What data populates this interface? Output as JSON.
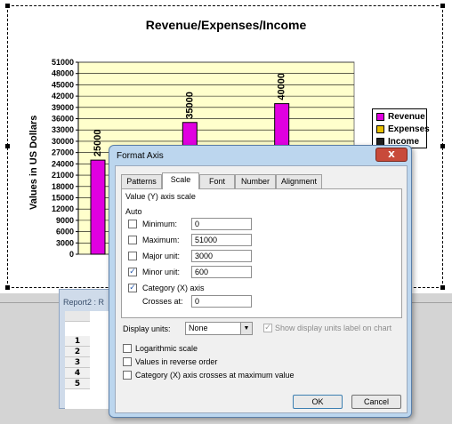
{
  "chart": {
    "title": "Revenue/Expenses/Income",
    "ylabel": "Values in US Dollars",
    "legend": [
      {
        "label": "Revenue",
        "color": "#e000e0"
      },
      {
        "label": "Expenses",
        "color": "#e8c000"
      },
      {
        "label": "Income",
        "color": "#202020"
      }
    ]
  },
  "chart_data": {
    "type": "bar",
    "title": "Revenue/Expenses/Income",
    "xlabel": "",
    "ylabel": "Values in US Dollars",
    "ylim": [
      0,
      51000
    ],
    "y_ticks": [
      0,
      3000,
      6000,
      9000,
      12000,
      15000,
      18000,
      21000,
      24000,
      27000,
      30000,
      33000,
      36000,
      39000,
      42000,
      45000,
      48000,
      51000
    ],
    "series": [
      {
        "name": "Revenue",
        "color": "#e000e0",
        "values": [
          25000,
          35000,
          40000
        ]
      },
      {
        "name": "Expenses",
        "color": "#e8c000",
        "values": [
          null,
          null,
          null
        ]
      },
      {
        "name": "Income",
        "color": "#202020",
        "values": [
          null,
          null,
          null
        ]
      }
    ],
    "data_labels": [
      "25000",
      "35000",
      "40000"
    ],
    "grid": true,
    "plot_background": "#ffffcc",
    "legend_position": "right"
  },
  "report": {
    "title": "Report2 : R",
    "rows": [
      "1",
      "2",
      "3",
      "4",
      "5"
    ]
  },
  "dialog": {
    "title": "Format Axis",
    "close_label": "X",
    "tabs": [
      "Patterns",
      "Scale",
      "Font",
      "Number",
      "Alignment"
    ],
    "active_tab": "Scale",
    "section_title": "Value (Y) axis scale",
    "auto_label": "Auto",
    "fields": [
      {
        "label": "Minimum:",
        "value": "0",
        "checked": false
      },
      {
        "label": "Maximum:",
        "value": "51000",
        "checked": false
      },
      {
        "label": "Major unit:",
        "value": "3000",
        "checked": false
      },
      {
        "label": "Minor unit:",
        "value": "600",
        "checked": true
      }
    ],
    "category_axis_label": "Category (X) axis",
    "category_axis_checked": true,
    "crosses_at_label": "Crosses at:",
    "crosses_at_value": "0",
    "display_units_label": "Display units:",
    "display_units_value": "None",
    "show_units_label": "Show display units label on chart",
    "options": [
      {
        "label": "Logarithmic scale",
        "checked": false
      },
      {
        "label": "Values in reverse order",
        "checked": false
      },
      {
        "label": "Category (X) axis crosses at maximum value",
        "checked": false
      }
    ],
    "ok_label": "OK",
    "cancel_label": "Cancel"
  }
}
